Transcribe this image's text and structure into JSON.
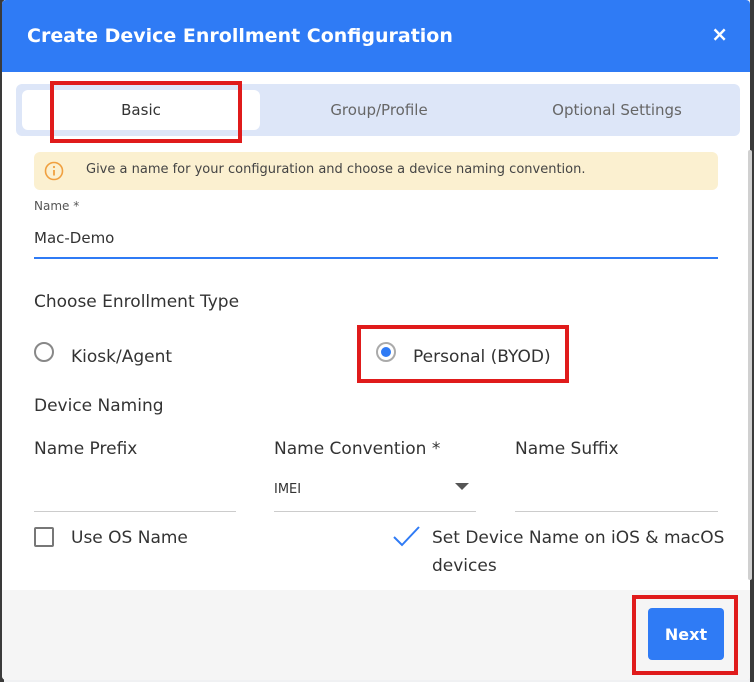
{
  "dialog": {
    "title": "Create Device Enrollment Configuration",
    "close_label": "×"
  },
  "tabs": [
    {
      "label": "Basic",
      "active": true
    },
    {
      "label": "Group/Profile",
      "active": false
    },
    {
      "label": "Optional Settings",
      "active": false
    }
  ],
  "info": {
    "text": "Give a name for your configuration and choose a device naming convention."
  },
  "name_field": {
    "label": "Name *",
    "value": "Mac-Demo"
  },
  "enrollment": {
    "heading": "Choose Enrollment Type",
    "options": [
      {
        "label": "Kiosk/Agent",
        "checked": false
      },
      {
        "label": "Personal (BYOD)",
        "checked": true
      }
    ]
  },
  "naming": {
    "heading": "Device Naming",
    "prefix_label": "Name Prefix",
    "prefix_value": "",
    "convention_label": "Name Convention *",
    "convention_value": "IMEI",
    "suffix_label": "Name Suffix",
    "suffix_value": ""
  },
  "options": {
    "use_os_name": {
      "label": "Use OS Name",
      "checked": false
    },
    "set_device_name": {
      "label_line1": "Set Device Name on iOS & macOS",
      "label_line2": "devices",
      "checked": true
    }
  },
  "footer": {
    "next_label": "Next"
  },
  "colors": {
    "accent": "#2f7bf5",
    "highlight": "#e01b1b",
    "info_bg": "#fbf0d0"
  }
}
